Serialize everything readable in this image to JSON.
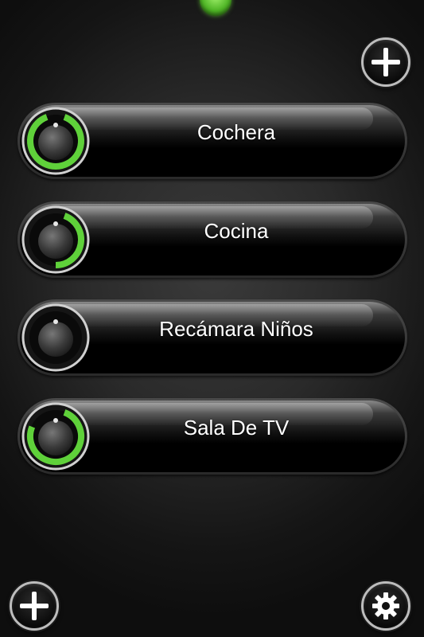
{
  "header": {
    "add_top_icon": "plus-icon"
  },
  "rooms": [
    {
      "label": "Cochera",
      "level": 1.0
    },
    {
      "label": "Cocina",
      "level": 0.5
    },
    {
      "label": "Recámara Niños",
      "level": 0.0
    },
    {
      "label": "Sala De TV",
      "level": 0.85
    }
  ],
  "footer": {
    "add_bottom_icon": "plus-icon",
    "settings_icon": "gear-icon"
  },
  "colors": {
    "accent_green": "#5fd13a",
    "ring_silver": "#c8c8c8",
    "background": "#2a2a2a"
  }
}
